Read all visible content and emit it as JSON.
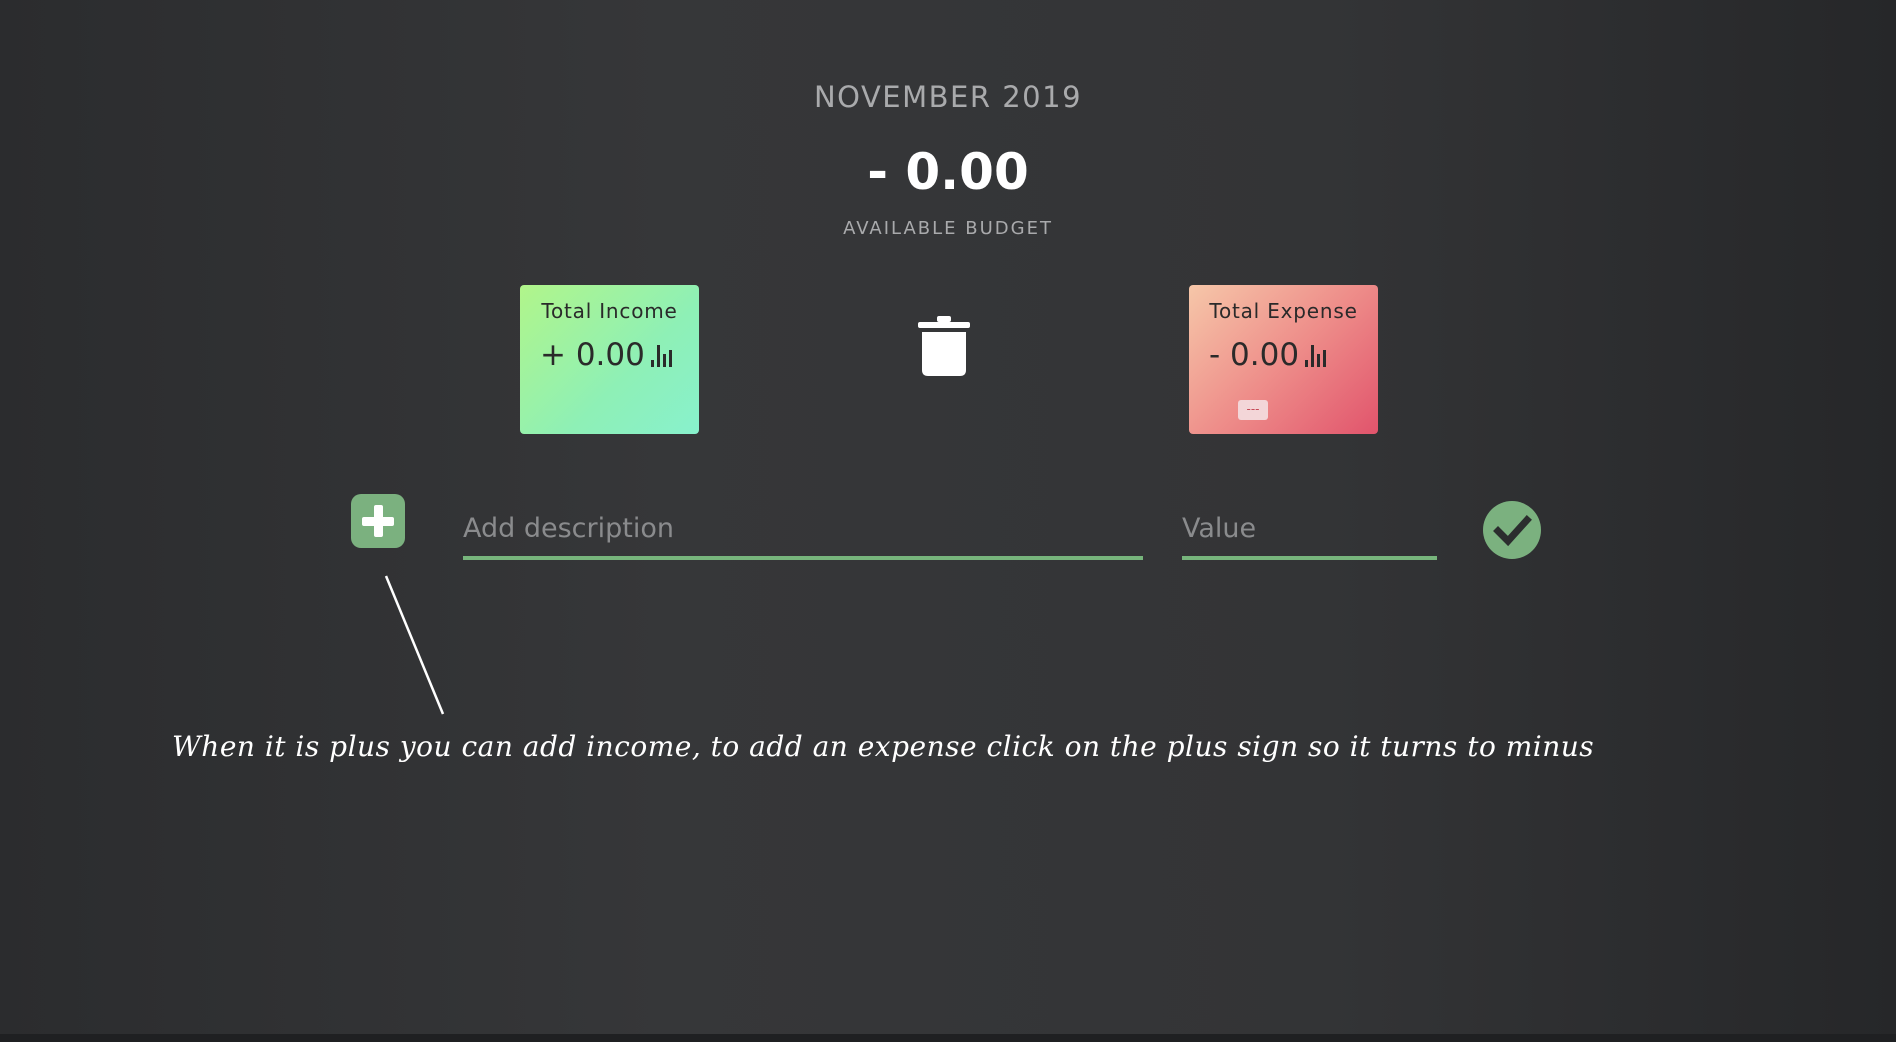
{
  "header": {
    "month": "NOVEMBER 2019",
    "budget_value": "- 0.00",
    "budget_label": "AVAILABLE BUDGET"
  },
  "income_card": {
    "title": "Total Income",
    "value": "+ 0.00",
    "icon": "bar-chart-icon",
    "colors": [
      "#b1f58a",
      "#88f1cd"
    ]
  },
  "expense_card": {
    "title": "Total Expense",
    "value": "- 0.00",
    "percentage": "---",
    "icon": "bar-chart-icon",
    "colors": [
      "#f6c7a9",
      "#e1546c"
    ]
  },
  "clear_button": {
    "icon": "trash-icon"
  },
  "add_form": {
    "toggle_icon": "plus-icon",
    "description_placeholder": "Add description",
    "value_placeholder": "Value",
    "submit_icon": "checkmark-icon",
    "accent_color": "#77b57c"
  },
  "annotation": {
    "text": "When it is plus you can add income, to add an expense click on the plus sign so it turns to minus"
  }
}
